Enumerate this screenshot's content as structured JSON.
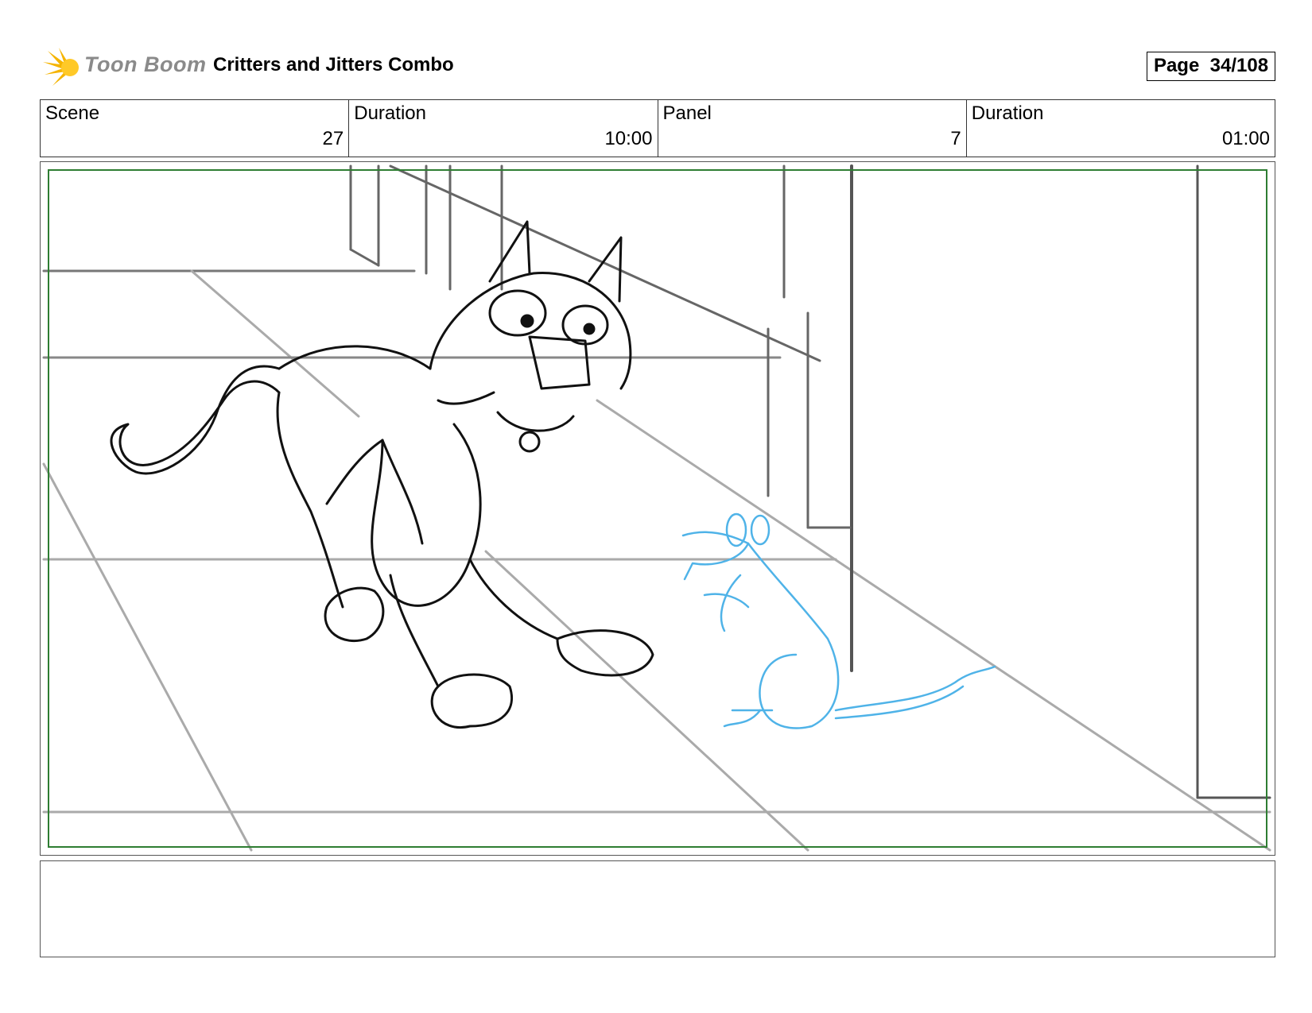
{
  "header": {
    "logo_text": "Toon Boom",
    "project_title": "Critters and Jitters Combo",
    "page_label": "Page",
    "page_number": "34/108"
  },
  "info": [
    {
      "label": "Scene",
      "value": "27"
    },
    {
      "label": "Duration",
      "value": "10:00"
    },
    {
      "label": "Panel",
      "value": "7"
    },
    {
      "label": "Duration",
      "value": "01:00"
    }
  ],
  "colors": {
    "logo_star": "#f5b400",
    "safe_frame": "#2e7d32",
    "cat_lines": "#111111",
    "mouse_lines": "#4fb3e8",
    "background_lines": "#9a9a9a"
  }
}
